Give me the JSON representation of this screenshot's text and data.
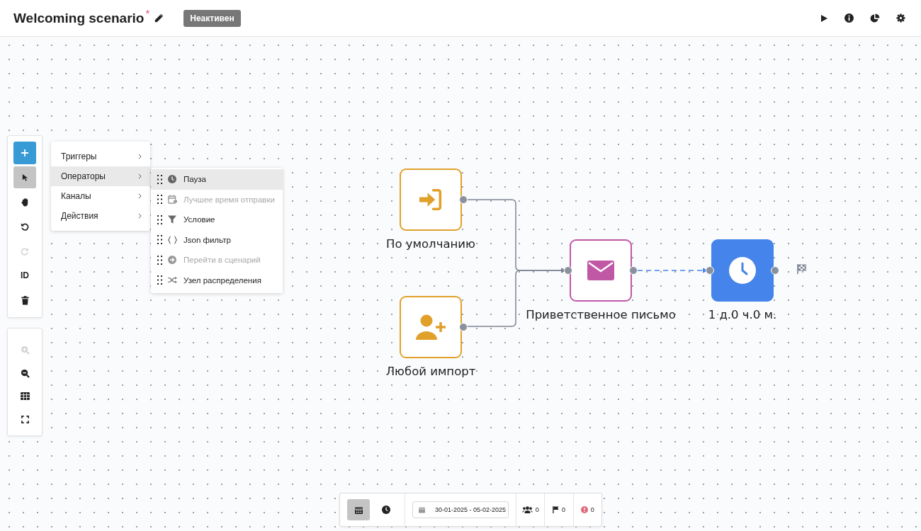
{
  "header": {
    "title": "Welcoming scenario",
    "modified_mark": "*",
    "status": "Неактивен"
  },
  "tools": [
    {
      "kind": "add",
      "selected": false,
      "disabled": false
    },
    {
      "kind": "pointer",
      "selected": true,
      "disabled": false
    },
    {
      "kind": "hand",
      "selected": false,
      "disabled": false
    },
    {
      "kind": "undo",
      "selected": false,
      "disabled": false
    },
    {
      "kind": "redo",
      "selected": false,
      "disabled": true
    },
    {
      "kind": "id",
      "label": "ID",
      "selected": false,
      "disabled": false
    },
    {
      "kind": "trash",
      "selected": false,
      "disabled": false
    }
  ],
  "view_tools": [
    {
      "kind": "zoom-in",
      "disabled": true
    },
    {
      "kind": "zoom-out",
      "disabled": false
    },
    {
      "kind": "grid",
      "disabled": false
    },
    {
      "kind": "fullscreen",
      "disabled": false
    }
  ],
  "menu": [
    {
      "label": "Триггеры",
      "selected": false
    },
    {
      "label": "Операторы",
      "selected": true
    },
    {
      "label": "Каналы",
      "selected": false
    },
    {
      "label": "Действия",
      "selected": false
    }
  ],
  "submenu": [
    {
      "kind": "clock",
      "label": "Пауза",
      "selected": true,
      "disabled": false
    },
    {
      "kind": "calendar",
      "label": "Лучшее время отправки",
      "selected": false,
      "disabled": true
    },
    {
      "kind": "filter",
      "label": "Условие",
      "selected": false,
      "disabled": false
    },
    {
      "kind": "braces",
      "label": "Json фильтр",
      "selected": false,
      "disabled": false
    },
    {
      "kind": "goto",
      "label": "Перейти в сценарий",
      "selected": false,
      "disabled": true
    },
    {
      "kind": "shuffle",
      "label": "Узел распределения",
      "selected": false,
      "disabled": false
    }
  ],
  "nodes": [
    {
      "kind": "enter",
      "label": "По умолчанию",
      "color": "#e0a02a"
    },
    {
      "kind": "import",
      "label": "Любой импорт",
      "color": "#e0a02a"
    },
    {
      "kind": "email",
      "label": "Приветственное письмо",
      "color": "#c058a6"
    },
    {
      "kind": "pause",
      "label": "1 д.0 ч.0 м.",
      "color": "#4584ea"
    }
  ],
  "bottom_bar": {
    "views": [
      {
        "kind": "calendar",
        "selected": true
      },
      {
        "kind": "clock",
        "selected": false
      }
    ],
    "date_range": "30-01-2025 - 05-02-2025",
    "counters": [
      {
        "kind": "users",
        "value": "0"
      },
      {
        "kind": "flag",
        "value": "0"
      },
      {
        "kind": "error",
        "value": "0"
      }
    ]
  }
}
